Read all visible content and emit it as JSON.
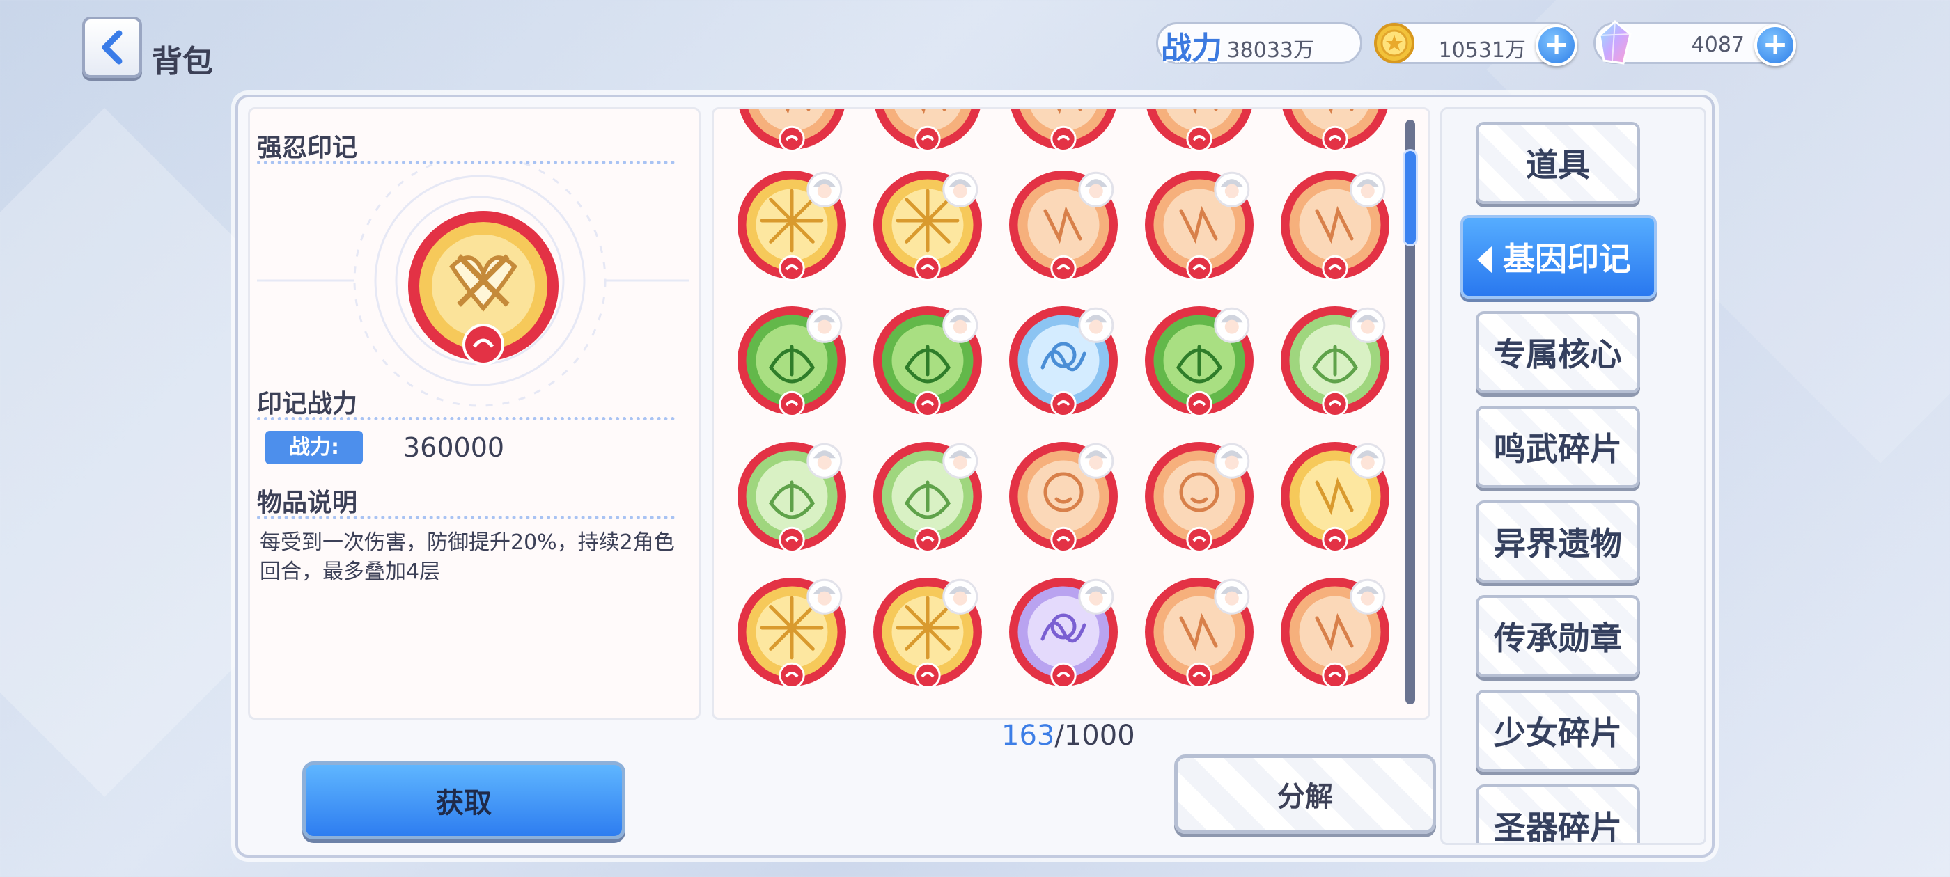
{
  "header": {
    "title": "背包",
    "power_label": "战力",
    "power_value": "38033万",
    "gold_value": "10531万",
    "gem_value": "4087"
  },
  "detail": {
    "item_name": "强忍印记",
    "power_section": "印记战力",
    "power_tag": "战力:",
    "power_value": "360000",
    "desc_section": "物品说明",
    "description": "每受到一次伤害，防御提升20%，持续2角色回合，最多叠加4层"
  },
  "inventory": {
    "count_current": "163",
    "count_sep": "/",
    "count_max": "1000",
    "items": [
      {
        "theme": "gold",
        "motif": "star"
      },
      {
        "theme": "gold",
        "motif": "star"
      },
      {
        "theme": "peach",
        "motif": "claw"
      },
      {
        "theme": "peach",
        "motif": "claw"
      },
      {
        "theme": "peach",
        "motif": "block"
      },
      {
        "theme": "green",
        "motif": "leaf"
      },
      {
        "theme": "green",
        "motif": "leaf"
      },
      {
        "theme": "blue",
        "motif": "swirl"
      },
      {
        "theme": "green",
        "motif": "heart"
      },
      {
        "theme": "lightgreen",
        "motif": "leaf"
      },
      {
        "theme": "lightgreen",
        "motif": "leaf"
      },
      {
        "theme": "lightgreen",
        "motif": "leaf"
      },
      {
        "theme": "peach",
        "motif": "face"
      },
      {
        "theme": "peach",
        "motif": "face"
      },
      {
        "theme": "gold",
        "motif": "glyph"
      },
      {
        "theme": "gold",
        "motif": "star"
      },
      {
        "theme": "gold",
        "motif": "burst"
      },
      {
        "theme": "purple",
        "motif": "butterfly"
      },
      {
        "theme": "peach",
        "motif": "spikes"
      },
      {
        "theme": "peach",
        "motif": "figure"
      }
    ]
  },
  "actions": {
    "get_label": "获取",
    "split_label": "分解"
  },
  "tabs": [
    {
      "label": "道具",
      "active": false
    },
    {
      "label": "基因印记",
      "active": true
    },
    {
      "label": "专属核心",
      "active": false
    },
    {
      "label": "鸣武碎片",
      "active": false
    },
    {
      "label": "异界遗物",
      "active": false
    },
    {
      "label": "传承勋章",
      "active": false
    },
    {
      "label": "少女碎片",
      "active": false
    },
    {
      "label": "圣器碎片",
      "active": false
    }
  ],
  "colors": {
    "accent_blue": "#2f7fe8",
    "badge_red": "#e33245",
    "gold": "#f2c23a"
  }
}
